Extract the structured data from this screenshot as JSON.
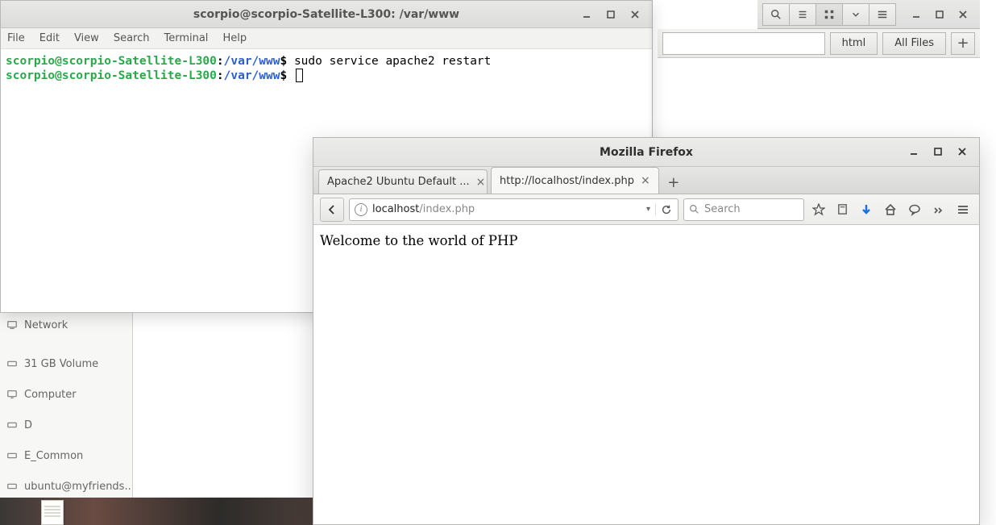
{
  "nautilus": {
    "buttons": {
      "html": "html",
      "all_files": "All Files"
    },
    "sidebar": [
      {
        "label": "Network"
      },
      {
        "label": "31 GB Volume"
      },
      {
        "label": "Computer"
      },
      {
        "label": "D"
      },
      {
        "label": "E_Common"
      },
      {
        "label": "ubuntu@myfriends..."
      }
    ]
  },
  "terminal": {
    "title": "scorpio@scorpio-Satellite-L300: /var/www",
    "menu": [
      "File",
      "Edit",
      "View",
      "Search",
      "Terminal",
      "Help"
    ],
    "prompt_user": "scorpio@scorpio-Satellite-L300",
    "prompt_path": "/var/www",
    "lines": [
      {
        "cmd": "sudo service apache2 restart"
      },
      {
        "cmd": ""
      }
    ]
  },
  "firefox": {
    "title": "Mozilla Firefox",
    "tabs": [
      {
        "label": "Apache2 Ubuntu Default ...",
        "active": false
      },
      {
        "label": "http://localhost/index.php",
        "active": true
      }
    ],
    "url_host": "localhost",
    "url_rest": "/index.php",
    "search_placeholder": "Search",
    "page_text": "Welcome to the world of PHP"
  }
}
